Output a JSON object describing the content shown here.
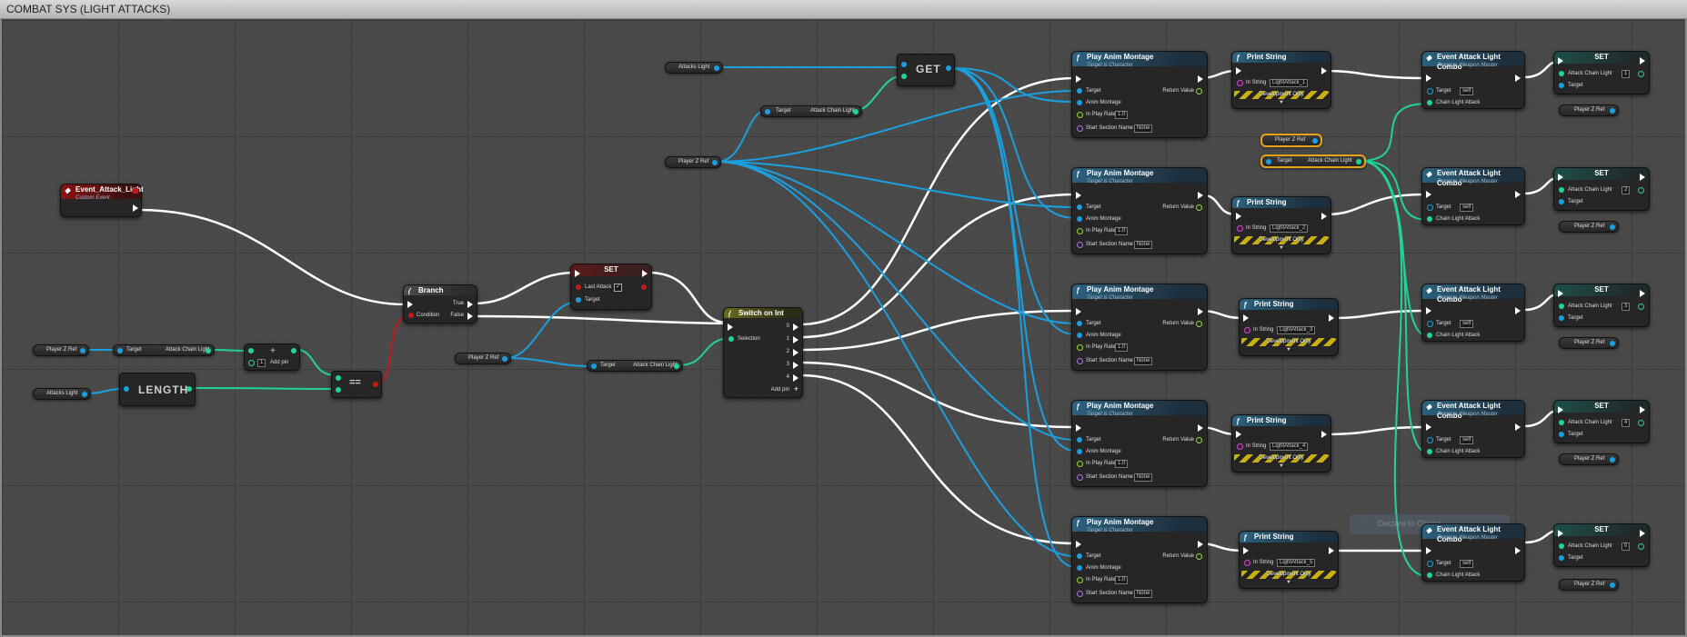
{
  "comment": {
    "title": "COMBAT SYS (LIGHT ATTACKS)"
  },
  "colors": {
    "exec": "#ffffff",
    "object": "#1aa0e0",
    "integer": "#21d39a",
    "boolean": "#c21b1b",
    "string": "#e040e0",
    "float": "#8ee03a"
  },
  "event": {
    "title": "Event_Attack_Light",
    "subtitle": "Custom Event"
  },
  "branch": {
    "title": "Branch",
    "true_label": "True",
    "false_label": "False",
    "condition_label": "Condition"
  },
  "set_last": {
    "title": "SET",
    "last_attack_label": "Last Attack",
    "target_label": "Target",
    "checked": "✓"
  },
  "switch": {
    "title": "Switch on Int",
    "selection_label": "Selection",
    "cases": [
      "0",
      "1",
      "2",
      "3",
      "4"
    ],
    "add_pin": "Add pin"
  },
  "get": {
    "title": "GET"
  },
  "length": {
    "title": "LENGTH"
  },
  "equals": {
    "title": "=="
  },
  "add": {
    "title": "+",
    "value": "1",
    "add_pin": "Add pin"
  },
  "vars": {
    "player_z_ref": "Player Z Ref",
    "attacks_light": "Attacks Light",
    "target": "Target",
    "attack_chain_light": "Attack Chain Light"
  },
  "montage": {
    "title": "Play Anim Montage",
    "subtitle": "Target is Character",
    "target": "Target",
    "return_value": "Return Value",
    "anim_montage": "Anim Montage",
    "play_rate": "In Play Rate",
    "play_rate_val": "1.0",
    "section": "Start Section Name",
    "section_val": "None"
  },
  "print": {
    "title": "Print String",
    "in_string": "In String",
    "dev_only": "Development Only",
    "strings": [
      "LightAttack_1",
      "LightAttack_2",
      "LightAttack_3",
      "LightAttack_4",
      "LightAttack_5"
    ]
  },
  "combo": {
    "title": "Event Attack Light Combo",
    "subtitle": "Target is Weapon Master",
    "target": "Target",
    "self": "self",
    "chain": "Chain Light Attack"
  },
  "setn": {
    "title": "SET",
    "label": "Attack Chain Light",
    "target": "Target",
    "values": [
      "1",
      "2",
      "3",
      "4",
      "0"
    ]
  },
  "ghost": {
    "text": "Declare to Object"
  }
}
